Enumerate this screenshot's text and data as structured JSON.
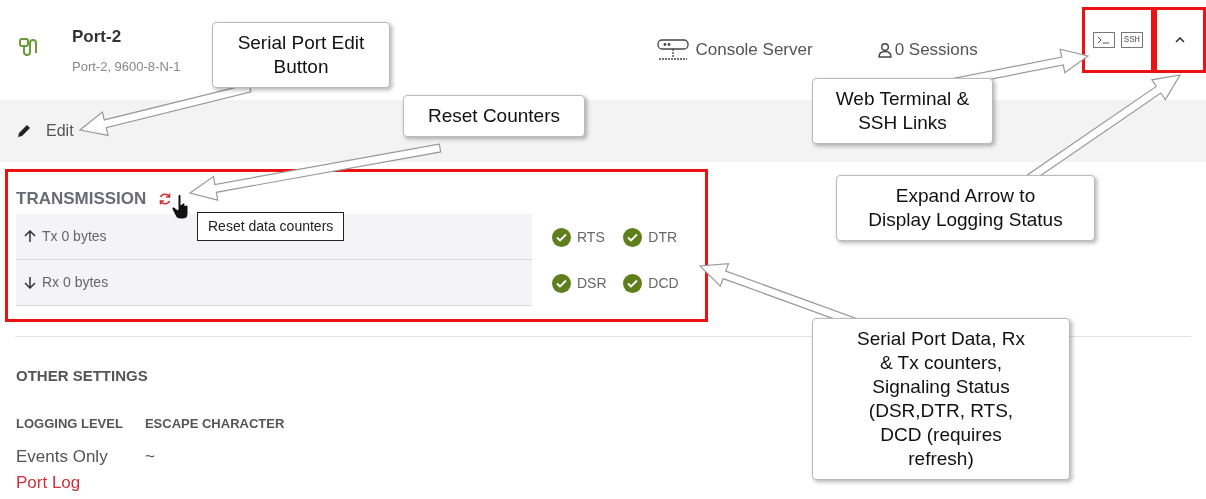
{
  "header": {
    "title": "Port-2",
    "subtitle": "Port-2, 9600-8-N-1",
    "device": "Console Server",
    "sessions": "0 Sessions",
    "terminal_links": [
      {
        "kind": "web"
      },
      {
        "kind": "ssh",
        "label": "SSH"
      }
    ],
    "expanded": false
  },
  "toolbar": {
    "edit": "Edit"
  },
  "transmission": {
    "title": "TRANSMISSION",
    "tooltip": "Reset data counters",
    "counters": [
      {
        "kind": "up",
        "label": "Tx 0 bytes"
      },
      {
        "kind": "down",
        "label": "Rx 0 bytes"
      }
    ],
    "signals": [
      {
        "label": "RTS",
        "active": true
      },
      {
        "label": "DTR",
        "active": true
      },
      {
        "label": "DSR",
        "active": true
      },
      {
        "label": "DCD",
        "active": true
      }
    ]
  },
  "other_settings": {
    "title": "OTHER SETTINGS",
    "columns": [
      {
        "label": "LOGGING LEVEL",
        "value": "Events Only"
      },
      {
        "label": "ESCAPE CHARACTER",
        "value": "~"
      }
    ],
    "link": "Port Log"
  },
  "annotations": [
    {
      "text": "Serial Port Edit Button"
    },
    {
      "text": "Reset Counters"
    },
    {
      "text": "Web Terminal & SSH Links"
    },
    {
      "text": "Expand Arrow to Display Logging Status"
    },
    {
      "text": "Serial Port Data, Rx & Tx counters, Signaling Status (DSR,DTR, RTS, DCD (requires refresh)"
    }
  ]
}
